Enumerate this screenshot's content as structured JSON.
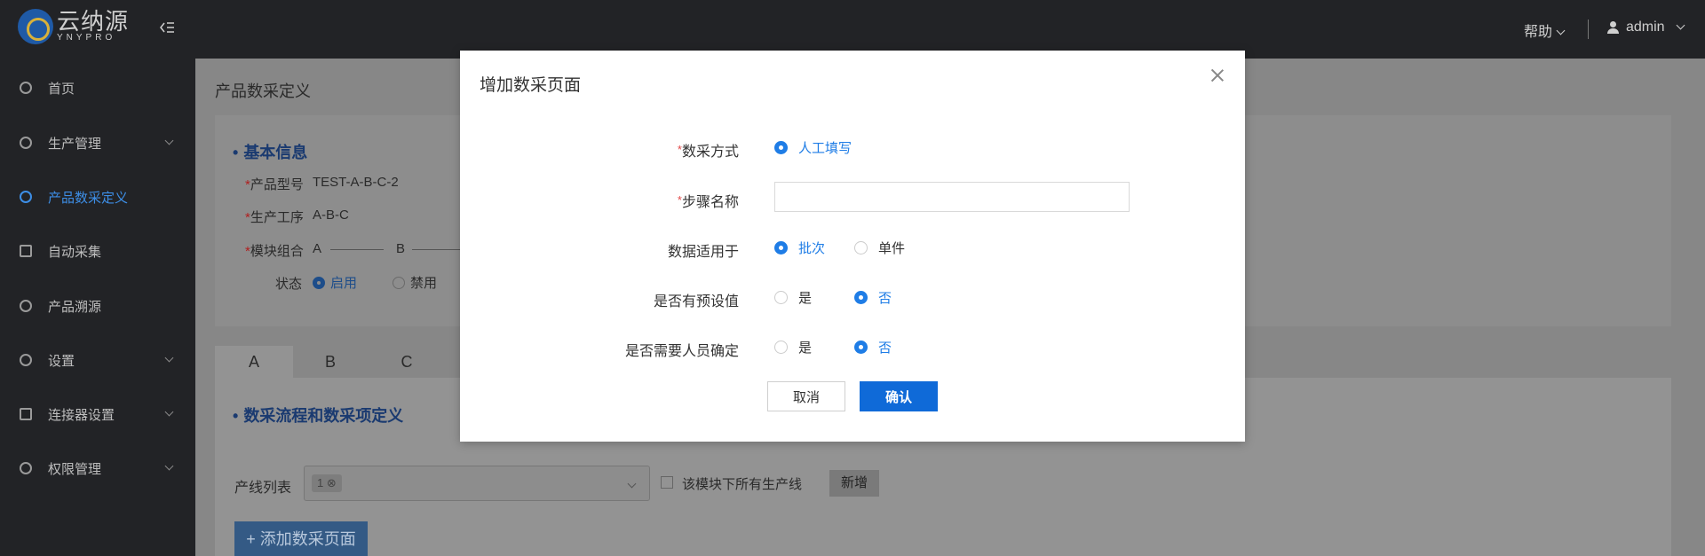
{
  "header": {
    "logo_cn": "云纳源",
    "logo_en": "YNYPRO",
    "help_label": "帮助",
    "user_name": "admin"
  },
  "sidebar": {
    "items": [
      {
        "label": "首页",
        "icon": "dashboard-icon"
      },
      {
        "label": "生产管理",
        "icon": "production-icon"
      },
      {
        "label": "产品数采定义",
        "icon": "data-definition-icon"
      },
      {
        "label": "自动采集",
        "icon": "auto-collect-icon"
      },
      {
        "label": "产品溯源",
        "icon": "trace-icon"
      },
      {
        "label": "设置",
        "icon": "settings-icon"
      },
      {
        "label": "连接器设置",
        "icon": "connector-icon"
      },
      {
        "label": "权限管理",
        "icon": "permission-icon"
      }
    ],
    "active_index": 2
  },
  "page": {
    "title": "产品数采定义",
    "basic_info": {
      "section_title": "基本信息",
      "model_label": "产品型号",
      "model_value": "TEST-A-B-C-2",
      "process_label": "生产工序",
      "process_value": "A-B-C",
      "module_label": "模块组合",
      "module_a": "A",
      "module_b": "B",
      "status_label": "状态",
      "status_enabled": "启用",
      "status_disabled": "禁用"
    },
    "tabs": [
      "A",
      "B",
      "C"
    ],
    "flow": {
      "section_title": "数采流程和数采项定义",
      "line_list_label": "产线列表",
      "selected_tag": "1",
      "all_lines_label": "该模块下所有生产线",
      "add_button": "新增",
      "add_page_button": "+ 添加数采页面"
    }
  },
  "modal": {
    "title": "增加数采页面",
    "method_label": "数采方式",
    "method_option": "人工填写",
    "step_name_label": "步骤名称",
    "step_name_value": "",
    "apply_label": "数据适用于",
    "apply_batch": "批次",
    "apply_single": "单件",
    "preset_label": "是否有预设值",
    "preset_yes": "是",
    "preset_no": "否",
    "confirm_label": "是否需要人员确定",
    "confirm_yes": "是",
    "confirm_no": "否",
    "cancel_button": "取消",
    "ok_button": "确认"
  }
}
